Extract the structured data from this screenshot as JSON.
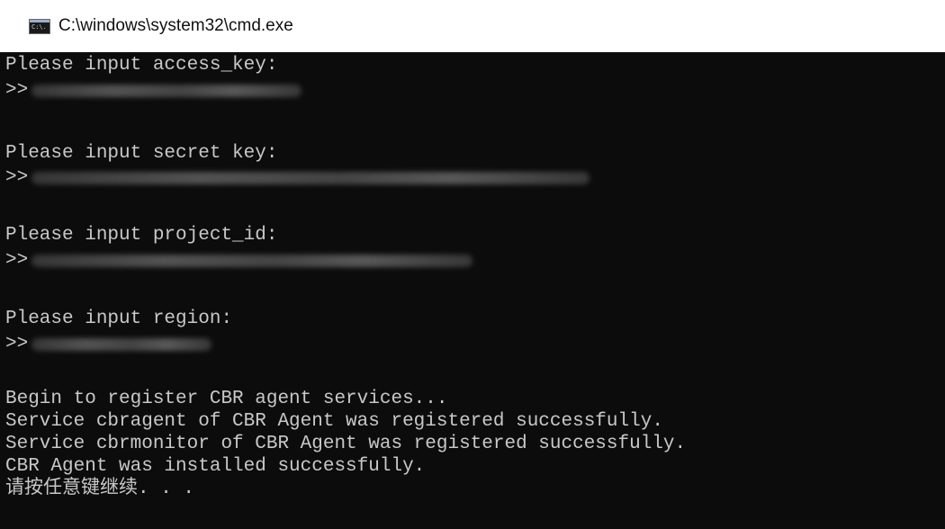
{
  "window": {
    "title": "C:\\windows\\system32\\cmd.exe",
    "icon_label": "C:\\."
  },
  "console": {
    "prompt_symbol": ">>",
    "lines": {
      "access_key_prompt": "Please input access_key:",
      "secret_key_prompt": "Please input secret key:",
      "project_id_prompt": "Please input project_id:",
      "region_prompt": "Please input region:",
      "begin_register": "Begin to register CBR agent services...",
      "cbragent_registered": "Service cbragent of CBR Agent was registered successfully.",
      "cbrmonitor_registered": "Service cbrmonitor of CBR Agent was registered successfully.",
      "agent_installed": "CBR Agent was installed successfully.",
      "press_any_key": "请按任意键继续. . ."
    }
  },
  "colors": {
    "console_background": "#0c0c0c",
    "console_text": "#c8c8c8",
    "titlebar_background": "#ffffff"
  }
}
